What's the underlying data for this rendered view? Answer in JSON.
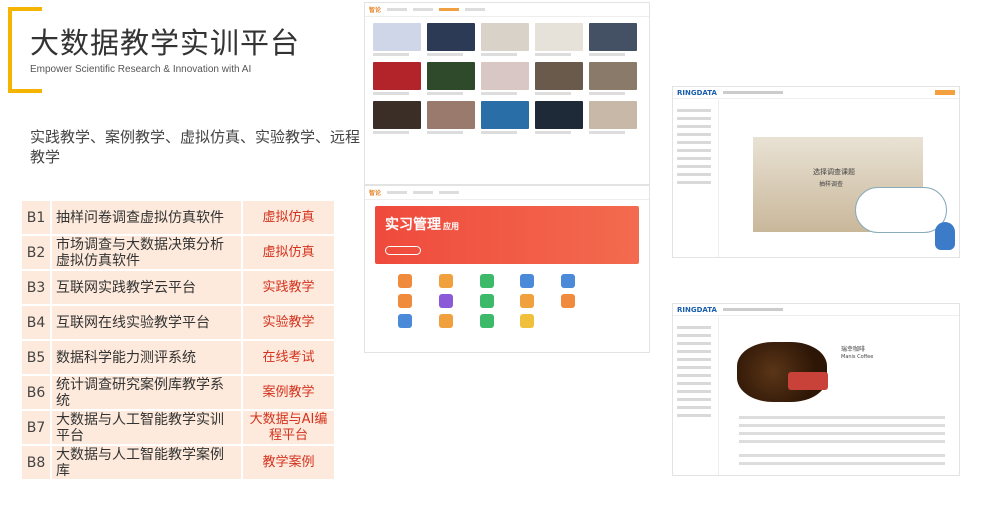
{
  "header": {
    "title": "大数据教学实训平台",
    "subtitle": "Empower Scientific Research & Innovation with AI"
  },
  "intro": "实践教学、案例教学、虚拟仿真、实验教学、远程教学",
  "products": [
    {
      "code": "B1",
      "name": "抽样问卷调查虚拟仿真软件",
      "tag": "虚拟仿真"
    },
    {
      "code": "B2",
      "name": "市场调查与大数据决策分析虚拟仿真软件",
      "tag": "虚拟仿真"
    },
    {
      "code": "B3",
      "name": "互联网实践教学云平台",
      "tag": "实践教学"
    },
    {
      "code": "B4",
      "name": "互联网在线实验教学平台",
      "tag": "实验教学"
    },
    {
      "code": "B5",
      "name": "数据科学能力测评系统",
      "tag": "在线考试"
    },
    {
      "code": "B6",
      "name": "统计调查研究案例库教学系统",
      "tag": "案例教学"
    },
    {
      "code": "B7",
      "name": "大数据与人工智能教学实训平台",
      "tag": "大数据与AI编程平台"
    },
    {
      "code": "B8",
      "name": "大数据与人工智能教学案例库",
      "tag": "教学案例"
    }
  ],
  "screens": {
    "case_library": {
      "logo": "智论"
    },
    "practice": {
      "logo": "智论",
      "banner_title": "实习管理",
      "banner_suffix": "应用"
    },
    "simulation": {
      "logo": "RINGDATA",
      "overlay_line1": "选择调查课题",
      "overlay_line2": "抽样调查"
    },
    "coffee_case": {
      "logo": "RINGDATA",
      "case_title": "瑞幸咖啡",
      "case_subtitle": "Manis Coffee"
    }
  },
  "colors": {
    "accent": "#f4b400",
    "tag_red": "#d4321e",
    "row_bg": "#fdeadc"
  }
}
